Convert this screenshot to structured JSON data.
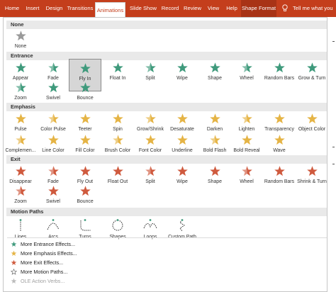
{
  "ribbon": {
    "tabs": [
      "Home",
      "Insert",
      "Design",
      "Transitions",
      "Animations",
      "Slide Show",
      "Record",
      "Review",
      "View",
      "Help",
      "Shape Format"
    ],
    "active_tab": "Animations",
    "tell_me": "Tell me what you",
    "color": "#c43e1c"
  },
  "gallery": {
    "categories": {
      "none": "None",
      "entrance": "Entrance",
      "emphasis": "Emphasis",
      "exit": "Exit",
      "motion": "Motion Paths"
    },
    "none_items": [
      "None"
    ],
    "entrance_items": [
      "Appear",
      "Fade",
      "Fly In",
      "Float In",
      "Split",
      "Wipe",
      "Shape",
      "Wheel",
      "Random Bars",
      "Grow & Turn",
      "Zoom",
      "Swivel",
      "Bounce"
    ],
    "selected_item": "Fly In",
    "emphasis_items": [
      "Pulse",
      "Color Pulse",
      "Teeter",
      "Spin",
      "Grow/Shrink",
      "Desaturate",
      "Darken",
      "Lighten",
      "Transparency",
      "Object Color",
      "Complemen...",
      "Line Color",
      "Fill Color",
      "Brush Color",
      "Font Color",
      "Underline",
      "Bold Flash",
      "Bold Reveal",
      "Wave"
    ],
    "exit_items": [
      "Disappear",
      "Fade",
      "Fly Out",
      "Float Out",
      "Split",
      "Wipe",
      "Shape",
      "Wheel",
      "Random Bars",
      "Shrink & Turn",
      "Zoom",
      "Swivel",
      "Bounce"
    ],
    "motion_items": [
      "Lines",
      "Arcs",
      "Turns",
      "Shapes",
      "Loops",
      "Custom Path"
    ],
    "colors": {
      "entrance": "#3f9a7c",
      "emphasis": "#e5b445",
      "exit": "#cf5a3e",
      "none": "#9a9a9a",
      "selected_bg": "#d6d6d6"
    }
  },
  "more_links": [
    {
      "label": "More Entrance Effects...",
      "icon": "entrance-star-icon",
      "enabled": true
    },
    {
      "label": "More Emphasis Effects...",
      "icon": "emphasis-star-icon",
      "enabled": true
    },
    {
      "label": "More Exit Effects...",
      "icon": "exit-star-icon",
      "enabled": true
    },
    {
      "label": "More Motion Paths...",
      "icon": "motion-star-icon",
      "enabled": true
    },
    {
      "label": "OLE Action Verbs...",
      "icon": "ole-icon",
      "enabled": false
    }
  ]
}
